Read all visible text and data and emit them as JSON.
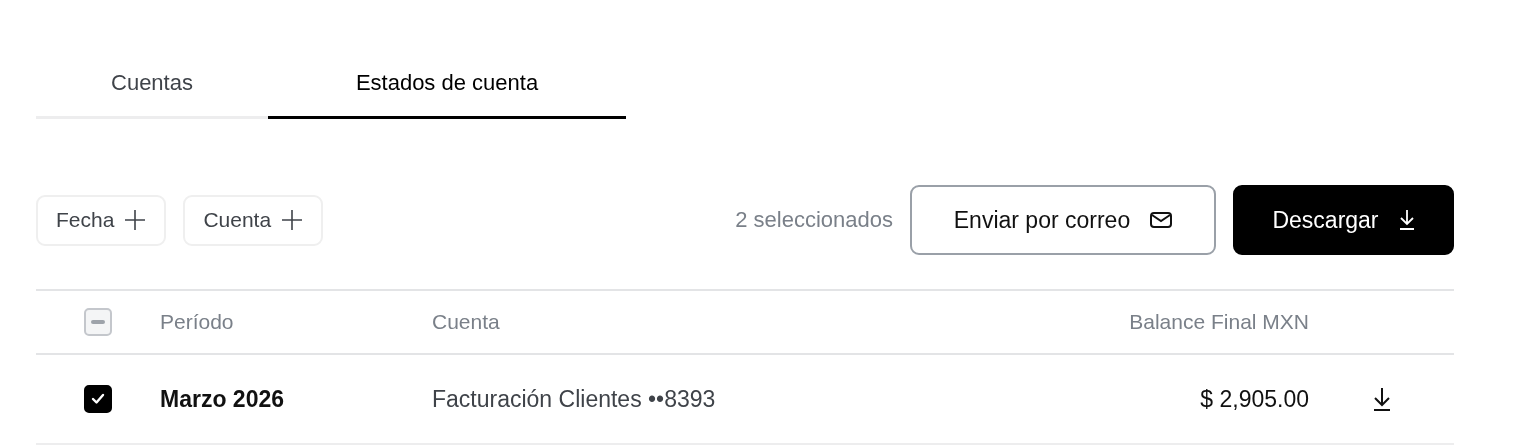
{
  "tabs": [
    {
      "label": "Cuentas",
      "selected": false
    },
    {
      "label": "Estados de cuenta",
      "selected": true
    }
  ],
  "filters": [
    {
      "label": "Fecha"
    },
    {
      "label": "Cuenta"
    }
  ],
  "selection_count": "2 seleccionados",
  "actions": [
    {
      "label": "Enviar por correo",
      "kind": "secondary"
    },
    {
      "label": "Descargar",
      "kind": "primary"
    }
  ],
  "table": {
    "select_all": {
      "indeterminate": true
    },
    "columns": [
      "Período",
      "Cuenta",
      "Balance Final MXN"
    ],
    "rows": [
      {
        "selected": true,
        "period": "Marzo 2026",
        "account": "Facturación Clientes ••8393",
        "balance": "$ 2,905.00"
      }
    ]
  }
}
